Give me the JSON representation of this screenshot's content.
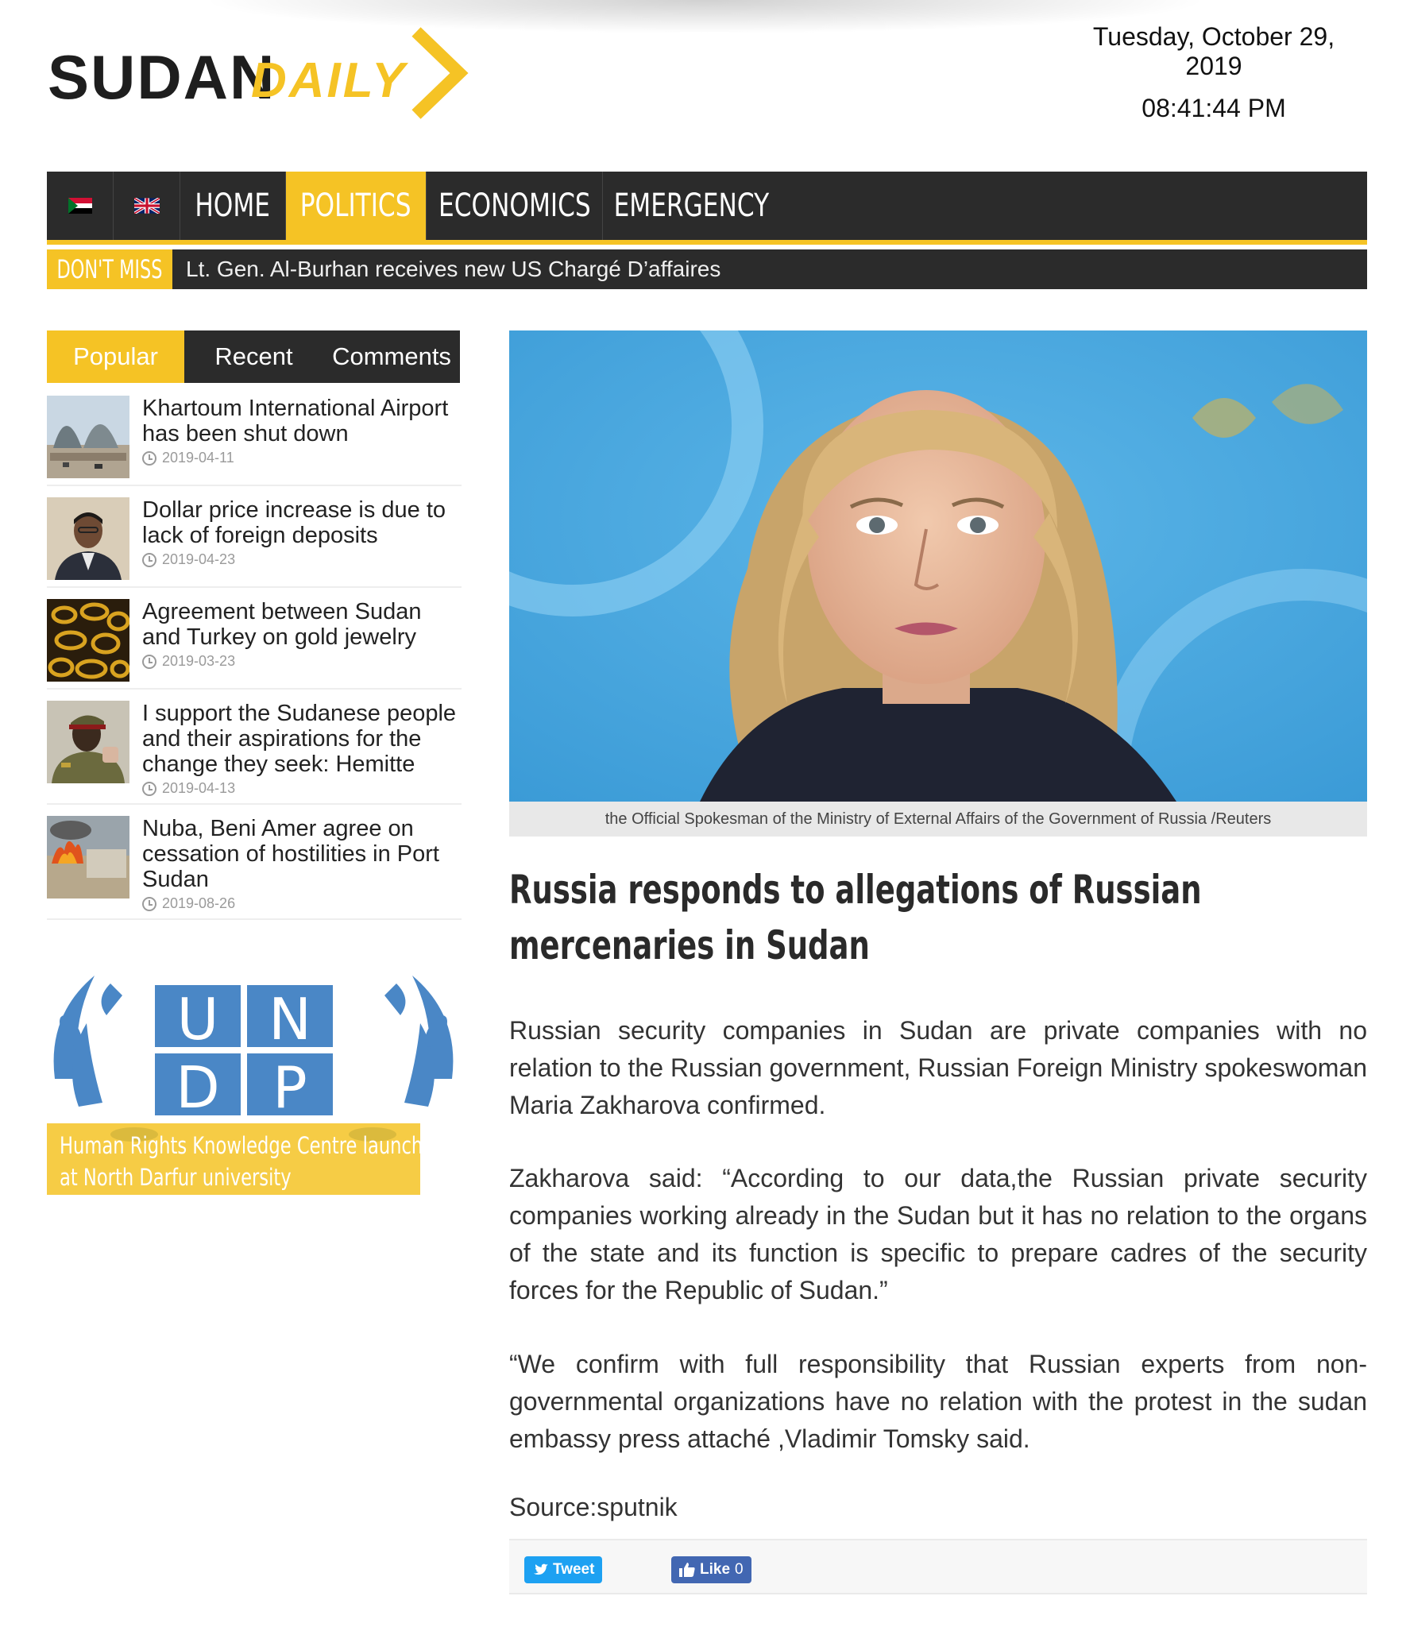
{
  "brand": {
    "word1": "SUDAN",
    "word2": "DAILY"
  },
  "header": {
    "date": "Tuesday, October 29, 2019",
    "time": "08:41:44 PM"
  },
  "nav": {
    "items": [
      "HOME",
      "POLITICS",
      "ECONOMICS",
      "EMERGENCY"
    ],
    "active": "POLITICS"
  },
  "ticker": {
    "label": "DON'T MISS",
    "headline": "Lt. Gen. Al-Burhan receives new US Chargé D’affaires"
  },
  "sidebar": {
    "tabs": [
      "Popular",
      "Recent",
      "Comments"
    ],
    "popular": [
      {
        "title": "Khartoum International Airport has been shut down",
        "date": "2019-04-11"
      },
      {
        "title": "Dollar price increase is due to lack of foreign deposits",
        "date": "2019-04-23"
      },
      {
        "title": "Agreement between Sudan and Turkey on gold jewelry",
        "date": "2019-03-23"
      },
      {
        "title": "I support the Sudanese people and their aspirations for the change they seek: Hemitte",
        "date": "2019-04-13"
      },
      {
        "title": "Nuba, Beni Amer agree on cessation of hostilities in Port Sudan",
        "date": "2019-08-26"
      }
    ],
    "feature": {
      "logo_text": [
        "U",
        "N",
        "D",
        "P"
      ],
      "caption_line1": "Human Rights Knowledge Centre launched",
      "caption_line2": "at North Darfur university"
    }
  },
  "article": {
    "image_caption": "the Official Spokesman of the Ministry of External Affairs of the Government of Russia /Reuters",
    "title": "Russia responds to allegations of Russian mercenaries in Sudan",
    "paragraphs": [
      "Russian security companies in Sudan are private companies with no relation to the Russian government, Russian Foreign Ministry spokeswoman Maria Zakharova confirmed.",
      "Zakharova said: “According to our data,the Russian private security companies  working already in the Sudan but it has no relation  to the organs of the state and its function is specific to prepare cadres of the security forces for the Republic of Sudan.”",
      "“We confirm with full responsibility that Russian experts from non-governmental organizations have no relation with the protest in the sudan embassy press attaché ,Vladimir Tomsky said.",
      "Source:sputnik"
    ],
    "share": {
      "tweet": "Tweet",
      "like": "Like",
      "like_count": "0"
    }
  },
  "colors": {
    "accent": "#f5c325",
    "dark": "#2b2b2b",
    "twitter": "#1da1f2",
    "facebook": "#4267b2"
  }
}
